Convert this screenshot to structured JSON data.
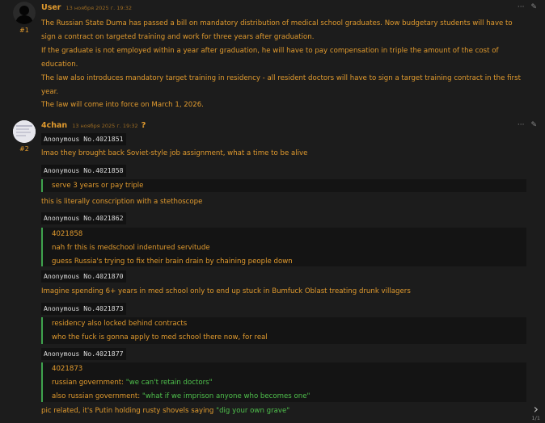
{
  "posts": [
    {
      "author": "User",
      "timestamp": "13 ноября 2025 г. 19:32",
      "number": "#1",
      "paragraphs": [
        "The Russian State Duma has passed a bill on mandatory distribution of medical school graduates. Now budgetary students will have to sign a contract on targeted training and work for three years after graduation.",
        "If the graduate is not employed within a year after graduation, he will have to pay compensation in triple the amount of the cost of education.",
        "The law also introduces mandatory target training in residency - all resident doctors will have to sign a target training contract in the first year.",
        "The law will come into force on March 1, 2026."
      ]
    },
    {
      "author": "4chan",
      "timestamp": "13 ноября 2025 г. 19:32",
      "badge": "?",
      "number": "#2",
      "anon1": "Anonymous No.4021851",
      "text1": "lmao they brought back Soviet-style job assignment, what a time to be alive",
      "anon2": "Anonymous No.4021858",
      "quote2": [
        "serve 3 years or pay triple"
      ],
      "text2": "this is literally conscription with a stethoscope",
      "anon3": "Anonymous No.4021862",
      "quote3": [
        "4021858",
        "nah fr this is medschool indentured servitude",
        "guess Russia's trying to fix their brain drain by chaining people down"
      ],
      "anon4": "Anonymous No.4021870",
      "text4": "Imagine spending 6+ years in med school only to end up stuck in Bumfuck Oblast treating drunk villagers",
      "anon5": "Anonymous No.4021873",
      "quote5": [
        "residency also locked behind contracts",
        "who the fuck is gonna apply to med school there now, for real"
      ],
      "anon6": "Anonymous No.4021877",
      "quote6_ref": "4021873",
      "quote6_l1_prefix": "russian government: ",
      "quote6_l1_green": "\"we can't retain doctors\"",
      "quote6_l2_prefix": "also russian government: ",
      "quote6_l2_green": "\"what if we imprison anyone who becomes one\"",
      "final_prefix": "pic related, it's Putin holding rusty shovels saying ",
      "final_green": "\"dig your own grave\""
    }
  ],
  "actions": {
    "more": "···",
    "edit": "✎"
  },
  "pagination": {
    "next": "›",
    "count": "1/1"
  }
}
